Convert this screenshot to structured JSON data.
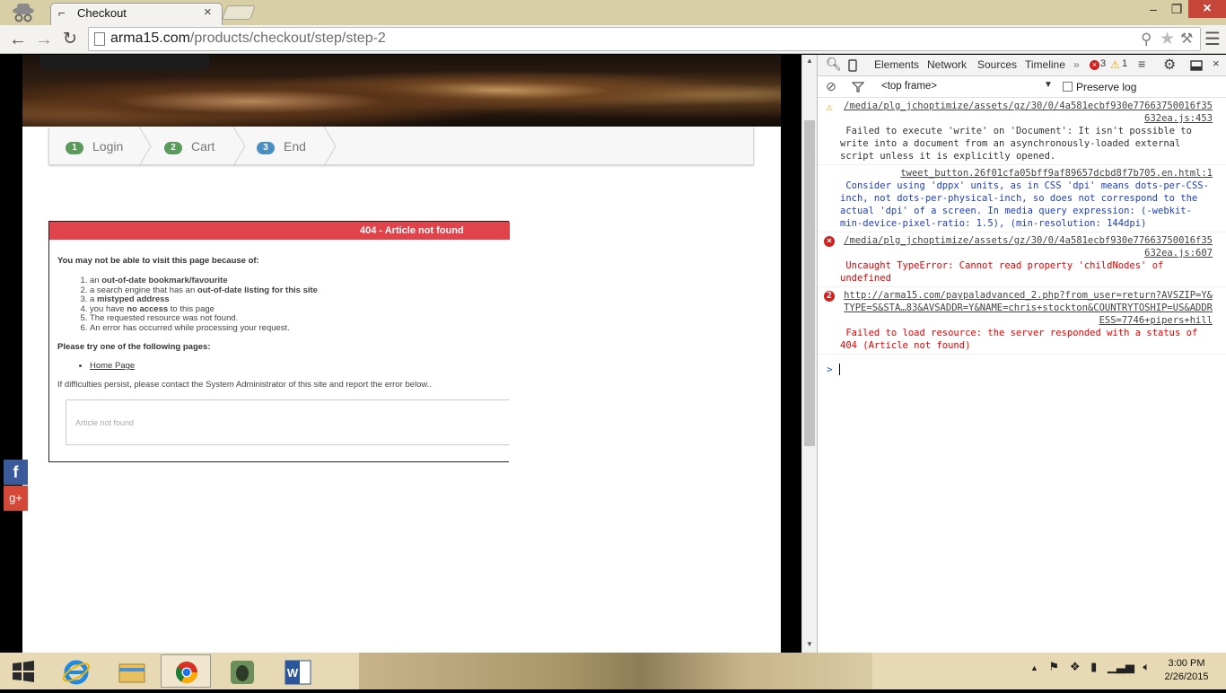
{
  "browser": {
    "tab_title": "Checkout",
    "url_domain": "arma15.com",
    "url_path": "/products/checkout/step/step-2"
  },
  "checkout_steps": [
    {
      "num": "1",
      "label": "Login"
    },
    {
      "num": "2",
      "label": "Cart"
    },
    {
      "num": "3",
      "label": "End"
    }
  ],
  "error_page": {
    "heading": "404 - Article not found",
    "intro": "You may not be able to visit this page because of:",
    "reasons": [
      {
        "pre": "an ",
        "bold": "out-of-date bookmark/favourite",
        "post": ""
      },
      {
        "pre": "a search engine that has an ",
        "bold": "out-of-date listing for this site",
        "post": ""
      },
      {
        "pre": "a ",
        "bold": "mistyped address",
        "post": ""
      },
      {
        "pre": "you have ",
        "bold": "no access",
        "post": " to this page"
      },
      {
        "pre": "The requested resource was not found.",
        "bold": "",
        "post": ""
      },
      {
        "pre": "An error has occurred while processing your request.",
        "bold": "",
        "post": ""
      }
    ],
    "try_text": "Please try one of the following pages:",
    "home_link": "Home Page",
    "contact_text": "If difficulties persist, please contact the System Administrator of this site and report the error below..",
    "detail": "Article not found"
  },
  "social": {
    "facebook": "f",
    "googleplus": "g+"
  },
  "devtools": {
    "tabs": [
      "Elements",
      "Network",
      "Sources",
      "Timeline"
    ],
    "error_count": "3",
    "warning_count": "1",
    "frame_select": "<top frame>",
    "preserve_log": "Preserve log",
    "messages": [
      {
        "level": "warn",
        "source": "/media/plg_jchoptimize/assets/gz/30/0/4a581ecbf930e77663750016f35632ea.js:453",
        "text": " Failed to execute 'write' on 'Document': It isn't possible to write into a document from an asynchronously-loaded external script unless it is explicitly opened."
      },
      {
        "level": "info",
        "source": "tweet_button.26f01cfa05bff9af89657dcbd8f7b705.en.html:1",
        "text": " Consider using 'dppx' units, as in CSS 'dpi' means dots-per-CSS-inch, not dots-per-physical-inch, so does not correspond to the actual 'dpi' of a screen. In media query expression: (-webkit-min-device-pixel-ratio: 1.5), (min-resolution: 144dpi)"
      },
      {
        "level": "err",
        "badge": "×",
        "source": "/media/plg_jchoptimize/assets/gz/30/0/4a581ecbf930e77663750016f35632ea.js:607",
        "text": " Uncaught TypeError: Cannot read property 'childNodes' of undefined"
      },
      {
        "level": "err",
        "badge": "2",
        "source": "http://arma15.com/paypaladvanced_2.php?from_user=return?AVSZIP=Y&TYPE=S&STA…83&AVSADDR=Y&NAME=chris+stockton&COUNTRYTOSHIP=US&ADDRESS=7746+pipers+hill",
        "text": " Failed to load resource: the server responded with a status of 404 (Article not found)"
      }
    ],
    "prompt": ">"
  },
  "taskbar": {
    "clock_time": "3:00 PM",
    "clock_date": "2/26/2015",
    "apps": [
      "internet-explorer",
      "file-explorer",
      "chrome",
      "evernote",
      "word"
    ]
  }
}
